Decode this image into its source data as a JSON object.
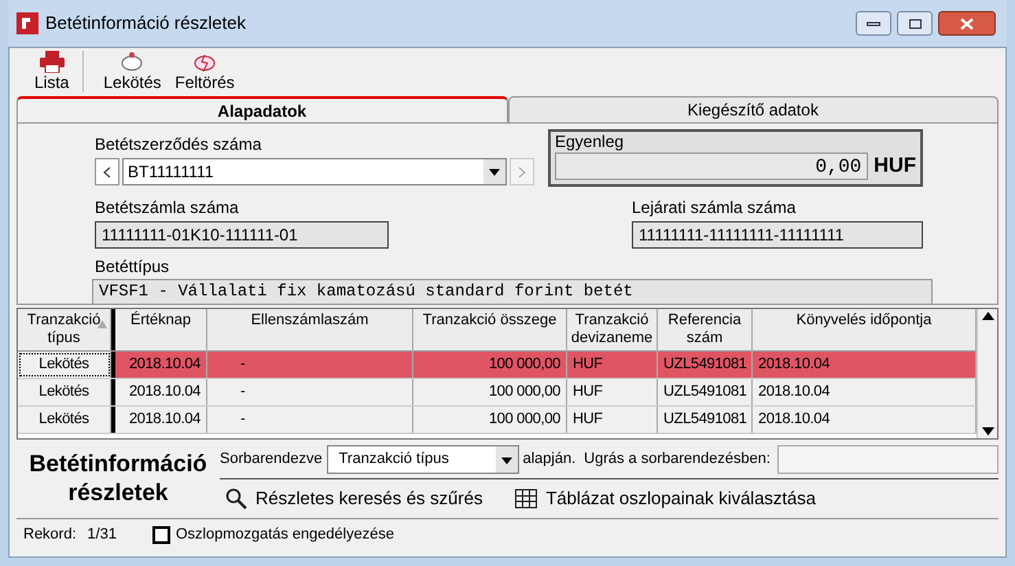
{
  "window": {
    "title": "Betétinformáció részletek"
  },
  "toolbar": [
    {
      "kind": "printer",
      "label": "Lista"
    },
    {
      "kind": "piggy",
      "label": "Lekötés"
    },
    {
      "kind": "broken",
      "label": "Feltörés"
    }
  ],
  "tabs": [
    {
      "label": "Alapadatok",
      "selected": true
    },
    {
      "label": "Kiegészítő adatok",
      "selected": false
    }
  ],
  "form": {
    "contract_label": "Betétszerződés száma",
    "contract_value": "BT11111111",
    "balance_label": "Egyenleg",
    "balance_value": "0,00",
    "currency": "HUF",
    "account_label": "Betétszámla száma",
    "account_value": "11111111-01K10-111111-01",
    "maturity_label": "Lejárati számla száma",
    "maturity_value": "11111111-11111111-11111111",
    "type_label": "Betéttípus",
    "type_value": "VFSF1 - Vállalati fix kamatozású standard forint betét"
  },
  "table": {
    "columns": [
      "Tranzakció típus",
      "Értéknap",
      "Ellenszámlaszám",
      "Tranzakció összege",
      "Tranzakció devizaneme",
      "Referencia szám",
      "Könyvelés időpontja"
    ],
    "rows": [
      {
        "selected": true,
        "cells": [
          "Lekötés",
          "2018.10.04",
          "-",
          "100 000,00",
          "HUF",
          "UZL5491081",
          "2018.10.04"
        ]
      },
      {
        "selected": false,
        "cells": [
          "Lekötés",
          "2018.10.04",
          "-",
          "100 000,00",
          "HUF",
          "UZL5491081",
          "2018.10.04"
        ]
      },
      {
        "selected": false,
        "cells": [
          "Lekötés",
          "2018.10.04",
          "-",
          "100 000,00",
          "HUF",
          "UZL5491081",
          "2018.10.04"
        ]
      }
    ]
  },
  "footer": {
    "title": "Betétinformáció részletek",
    "sort_label": "Sorbarendezve",
    "sort_value": "Tranzakció típus",
    "sort_suffix": "alapján.",
    "jump_label": "Ugrás a sorbarendezésben:",
    "search_link": "Részletes keresés és szűrés",
    "columns_link": "Táblázat oszlopainak kiválasztása"
  },
  "status_bar": {
    "record_label": "Rekord:",
    "record_value": "1/31",
    "checkbox_label": "Oszlopmozgatás engedélyezése",
    "checked": false
  }
}
